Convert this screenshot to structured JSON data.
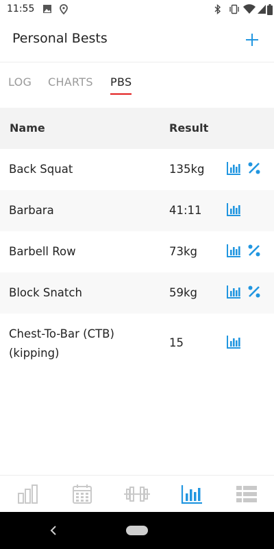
{
  "status": {
    "time": "11:55",
    "icons": [
      "image-icon",
      "location-icon",
      "bluetooth-icon",
      "vibrate-icon",
      "wifi-icon",
      "signal-icon",
      "battery-icon"
    ]
  },
  "header": {
    "title": "Personal Bests",
    "add_icon": "plus-icon"
  },
  "tabs": [
    {
      "label": "LOG",
      "active": false
    },
    {
      "label": "CHARTS",
      "active": false
    },
    {
      "label": "PBS",
      "active": true
    }
  ],
  "colors": {
    "accent": "#2196e0",
    "active_tab_underline": "#e21c1c",
    "header_row_bg": "#f3f3f3"
  },
  "table": {
    "headers": {
      "name": "Name",
      "result": "Result"
    },
    "rows": [
      {
        "name": "Back Squat",
        "result": "135kg",
        "actions": [
          "chart-icon",
          "percent-icon"
        ]
      },
      {
        "name": "Barbara",
        "result": "41:11",
        "actions": [
          "chart-icon"
        ]
      },
      {
        "name": "Barbell Row",
        "result": "73kg",
        "actions": [
          "chart-icon",
          "percent-icon"
        ]
      },
      {
        "name": "Block Snatch",
        "result": "59kg",
        "actions": [
          "chart-icon",
          "percent-icon"
        ]
      },
      {
        "name": "Chest-To-Bar (CTB)",
        "name_line2": "(kipping)",
        "result": "15",
        "actions": [
          "chart-icon"
        ]
      }
    ]
  },
  "bottom_nav": [
    {
      "icon": "stats-bars-icon",
      "active": false
    },
    {
      "icon": "calendar-icon",
      "active": false
    },
    {
      "icon": "dumbbell-icon",
      "active": false
    },
    {
      "icon": "chart-icon",
      "active": true
    },
    {
      "icon": "list-icon",
      "active": false
    }
  ]
}
